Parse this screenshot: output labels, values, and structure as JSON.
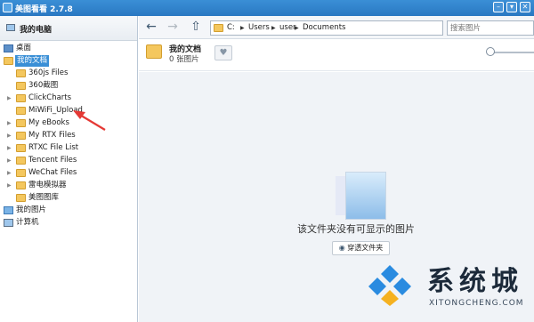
{
  "window": {
    "title": "美图看看 2.7.8",
    "minimize_glyph": "–",
    "restore_glyph": "▾",
    "close_glyph": "✕"
  },
  "sidebar": {
    "header": "我的电脑",
    "items": [
      {
        "label": "桌面",
        "icon": "desktop-icon",
        "level": 0
      },
      {
        "label": "我的文档",
        "icon": "folder-icon",
        "level": 0,
        "selected": true
      },
      {
        "label": "360js Files",
        "icon": "folder-icon",
        "level": 1
      },
      {
        "label": "360截图",
        "icon": "folder-icon",
        "level": 1
      },
      {
        "label": "ClickCharts",
        "icon": "folder-icon",
        "level": 1
      },
      {
        "label": "MiWiFi_Upload",
        "icon": "folder-icon",
        "level": 1
      },
      {
        "label": "My eBooks",
        "icon": "folder-icon",
        "level": 1
      },
      {
        "label": "My RTX Files",
        "icon": "folder-icon",
        "level": 1
      },
      {
        "label": "RTXC File List",
        "icon": "folder-icon",
        "level": 1
      },
      {
        "label": "Tencent Files",
        "icon": "folder-icon",
        "level": 1
      },
      {
        "label": "WeChat Files",
        "icon": "folder-icon",
        "level": 1
      },
      {
        "label": "雷电模拟器",
        "icon": "folder-icon",
        "level": 1
      },
      {
        "label": "美图图库",
        "icon": "folder-icon",
        "level": 1
      },
      {
        "label": "我的图片",
        "icon": "pictures-icon",
        "level": 0
      },
      {
        "label": "计算机",
        "icon": "computer-icon",
        "level": 0
      }
    ]
  },
  "toolbar": {
    "back_glyph": "←",
    "forward_glyph": "→",
    "up_glyph": "⇧",
    "breadcrumb": [
      "C:",
      "Users",
      "user",
      "Documents"
    ],
    "search_placeholder": "搜索图片"
  },
  "folder_info": {
    "name": "我的文档",
    "count": "0 张图片",
    "favorite_glyph": "♥"
  },
  "main": {
    "empty_message": "该文件夹没有可显示的图片",
    "browse_button": "穿透文件夹",
    "eye_glyph": "◉"
  },
  "watermark": {
    "text": "系统城",
    "sub": "XITONGCHENG.COM"
  },
  "colors": {
    "titlebar": "#2a78c2",
    "selection": "#3a8fd6",
    "annotation_arrow": "#e53935"
  }
}
